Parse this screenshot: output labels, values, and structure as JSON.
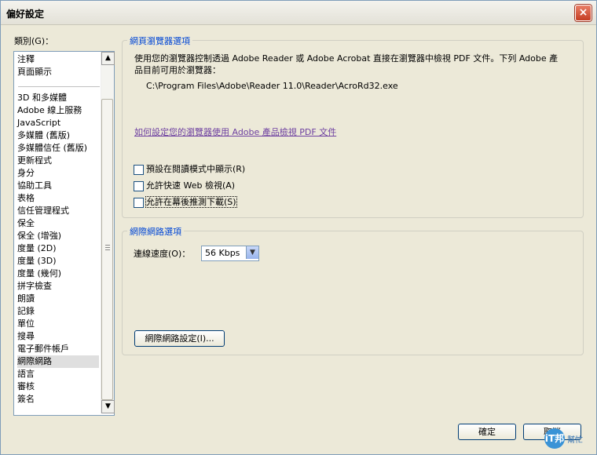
{
  "window": {
    "title": "偏好設定",
    "close_glyph": "×"
  },
  "categories": {
    "label": "類別(G)：",
    "top_items": [
      "注釋",
      "頁面顯示"
    ],
    "items": [
      "3D 和多媒體",
      "Adobe 線上服務",
      "JavaScript",
      "多媒體 (舊版)",
      "多媒體信任 (舊版)",
      "更新程式",
      "身分",
      "協助工具",
      "表格",
      "信任管理程式",
      "保全",
      "保全 (增強)",
      "度量 (2D)",
      "度量 (3D)",
      "度量 (幾何)",
      "拼字檢查",
      "朗讀",
      "記錄",
      "單位",
      "搜尋",
      "電子郵件帳戶",
      "網際網路",
      "語言",
      "審核",
      "簽名"
    ],
    "selected": "網際網路",
    "scroll_up": "▲",
    "scroll_down": "▼"
  },
  "browser_group": {
    "title": "網頁瀏覽器選項",
    "description": "使用您的瀏覽器控制透過 Adobe Reader 或 Adobe Acrobat 直接在瀏覽器中檢視 PDF 文件。下列 Adobe 產品目前可用於瀏覽器：",
    "path": "C:\\Program Files\\Adobe\\Reader 11.0\\Reader\\AcroRd32.exe",
    "link": "如何設定您的瀏覽器使用 Adobe 產品檢視 PDF 文件",
    "checkboxes": [
      {
        "label": "預設在閱讀模式中顯示(R)",
        "checked": false
      },
      {
        "label": "允許快速 Web 檢視(A)",
        "checked": false
      },
      {
        "label": "允許在幕後推測下載(S)",
        "checked": false
      }
    ]
  },
  "internet_group": {
    "title": "網際網路選項",
    "speed_label": "連線速度(O)：",
    "speed_value": "56 Kbps",
    "dropdown_glyph": "▼",
    "settings_button": "網際網路設定(I)..."
  },
  "footer": {
    "ok": "確定",
    "cancel": "取消"
  },
  "watermark": {
    "logo": "iT邦",
    "text": "幫忙"
  }
}
